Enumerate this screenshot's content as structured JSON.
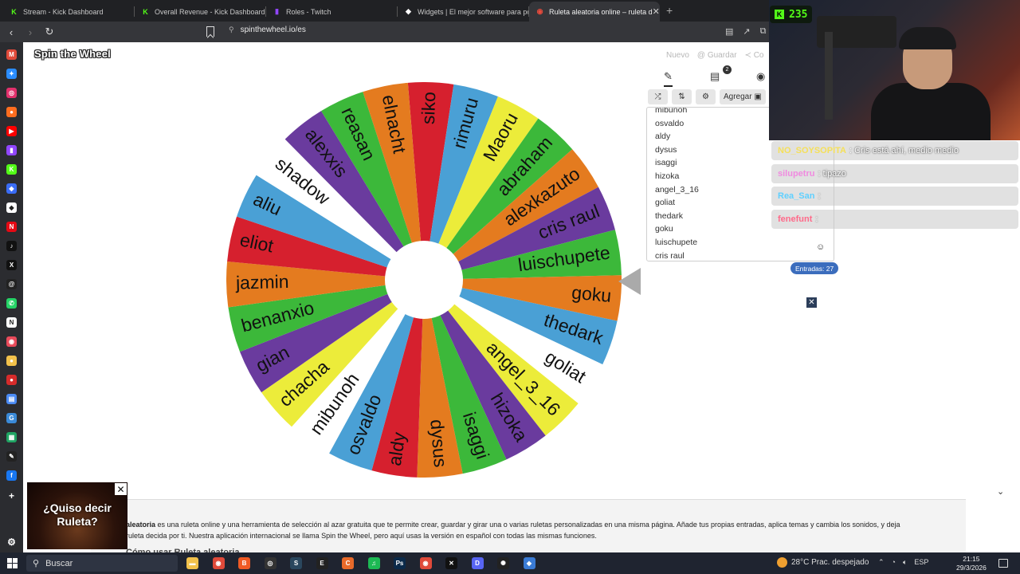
{
  "browser": {
    "tabs": [
      {
        "title": "Stream - Kick Dashboard",
        "favicon": "kick-icon",
        "color": "#53fc18",
        "glyph": "K",
        "active": false
      },
      {
        "title": "Overall Revenue - Kick Dashboard",
        "favicon": "kick-icon",
        "color": "#53fc18",
        "glyph": "K",
        "active": false
      },
      {
        "title": "Roles - Twitch",
        "favicon": "twitch-icon",
        "color": "#9146ff",
        "glyph": "▮",
        "active": false
      },
      {
        "title": "Widgets | El mejor software para pot",
        "favicon": "streamelements-icon",
        "color": "#ffffff",
        "glyph": "◆",
        "active": false
      },
      {
        "title": "Ruleta aleatoria online – ruleta d",
        "favicon": "spinthewheel-icon",
        "color": "#e94b3c",
        "glyph": "◉",
        "active": true
      }
    ],
    "url": "spinthewheel.io/es"
  },
  "page": {
    "logo": "Spin the Wheel",
    "top_links": [
      "Nuevo",
      "Guardar",
      "Co"
    ],
    "toolbar": {
      "add_label": "Agregar"
    },
    "entries_visible": [
      "mibunoh",
      "osvaldo",
      "aldy",
      "dysus",
      "isaggi",
      "hizoka",
      "angel_3_16",
      "goliat",
      "thedark",
      "goku",
      "luischupete",
      "cris raul"
    ],
    "entries_count_label": "Entradas: 27",
    "edit_badge": "2",
    "wheel": {
      "segments": [
        {
          "label": "siko",
          "color": "#d6202e"
        },
        {
          "label": "rimuru",
          "color": "#4aa0d5"
        },
        {
          "label": "Maoru",
          "color": "#ecec3a"
        },
        {
          "label": "abraham",
          "color": "#3cb83a"
        },
        {
          "label": "alexkazuto",
          "color": "#e47b1f"
        },
        {
          "label": "cris raul",
          "color": "#6a3b9e"
        },
        {
          "label": "luischupete",
          "color": "#3cb83a"
        },
        {
          "label": "goku",
          "color": "#e47b1f"
        },
        {
          "label": "thedark",
          "color": "#4aa0d5"
        },
        {
          "label": "goliat",
          "color": "#ffffff"
        },
        {
          "label": "angel_3_16",
          "color": "#ecec3a"
        },
        {
          "label": "hizoka",
          "color": "#6a3b9e"
        },
        {
          "label": "isaggi",
          "color": "#3cb83a"
        },
        {
          "label": "dysus",
          "color": "#e47b1f"
        },
        {
          "label": "aldy",
          "color": "#d6202e"
        },
        {
          "label": "osvaldo",
          "color": "#4aa0d5"
        },
        {
          "label": "mibunoh",
          "color": "#ffffff"
        },
        {
          "label": "chacha",
          "color": "#ecec3a"
        },
        {
          "label": "gian",
          "color": "#6a3b9e"
        },
        {
          "label": "benanxio",
          "color": "#3cb83a"
        },
        {
          "label": "jazmin",
          "color": "#e47b1f"
        },
        {
          "label": "eliot",
          "color": "#d6202e"
        },
        {
          "label": "aliu",
          "color": "#4aa0d5"
        },
        {
          "label": "shadow",
          "color": "#ffffff"
        },
        {
          "label": "alexxis",
          "color": "#6a3b9e"
        },
        {
          "label": "reasan",
          "color": "#3cb83a"
        },
        {
          "label": "elnacht",
          "color": "#e47b1f"
        }
      ]
    },
    "info": {
      "bold_word": "aleatoria",
      "text_line1": " es una ruleta online y una herramienta de selección al azar gratuita que te permite crear, guardar y girar una o varias ruletas personalizadas en una misma página. Añade tus propias entradas, aplica temas y cambia los sonidos, y deja",
      "text_line2": "ruleta decida por ti. Nuestra aplicación internacional se llama Spin the Wheel, pero aquí usas la versión en español con todas las mismas funciones.",
      "heading": "Cómo usar Ruleta aleatoria"
    },
    "ad": {
      "text": "¿Quiso decir Ruleta?"
    }
  },
  "overlay": {
    "viewer_count": "235",
    "chat": [
      {
        "user": "NO_SOYSOPITA",
        "user_color": "#f5e05a",
        "message": ": Cris está ahí, medio medio"
      },
      {
        "user": "silupetru",
        "user_color": "#f08ae0",
        "message": ": tipazo"
      },
      {
        "user": "Rea_San",
        "user_color": "#5fd0ff",
        "message": ":"
      },
      {
        "user": "fenefunt",
        "user_color": "#ff6a8a",
        "message": ":"
      }
    ]
  },
  "taskbar": {
    "search_label": "Buscar",
    "weather": "28°C  Prac. despejado",
    "lang": "ESP",
    "time": "21:15",
    "date": "29/3/2026",
    "apps": [
      {
        "name": "file-explorer-icon",
        "color": "#f2c14b",
        "glyph": "▬"
      },
      {
        "name": "chrome-icon",
        "color": "#e04a3a",
        "glyph": "◉"
      },
      {
        "name": "brave-icon",
        "color": "#f05a24",
        "glyph": "B"
      },
      {
        "name": "obs-icon",
        "color": "#333333",
        "glyph": "◎"
      },
      {
        "name": "steam-icon",
        "color": "#2a475e",
        "glyph": "S"
      },
      {
        "name": "epic-icon",
        "color": "#222222",
        "glyph": "E"
      },
      {
        "name": "app-orange-icon",
        "color": "#e86a2a",
        "glyph": "C"
      },
      {
        "name": "spotify-icon",
        "color": "#1db954",
        "glyph": "♫"
      },
      {
        "name": "photoshop-icon",
        "color": "#0b2a4a",
        "glyph": "Ps"
      },
      {
        "name": "chrome2-icon",
        "color": "#e04a3a",
        "glyph": "◉"
      },
      {
        "name": "capcut-icon",
        "color": "#111111",
        "glyph": "✕"
      },
      {
        "name": "discord-icon",
        "color": "#5865f2",
        "glyph": "D"
      },
      {
        "name": "openai-icon",
        "color": "#222222",
        "glyph": "✺"
      },
      {
        "name": "app-blue-icon",
        "color": "#3a7bd5",
        "glyph": "◆"
      }
    ]
  },
  "sidebar": {
    "items": [
      {
        "name": "gmail-icon",
        "color": "#e04a3a",
        "glyph": "M"
      },
      {
        "name": "messenger-icon",
        "color": "#2a8cff",
        "glyph": "✦"
      },
      {
        "name": "instagram-icon",
        "color": "#e1306c",
        "glyph": "◎"
      },
      {
        "name": "app-orange-icon",
        "color": "#ff6d1f",
        "glyph": "●"
      },
      {
        "name": "youtube-icon",
        "color": "#ff0000",
        "glyph": "▶"
      },
      {
        "name": "twitch-icon",
        "color": "#9146ff",
        "glyph": "▮"
      },
      {
        "name": "kick-icon",
        "color": "#53fc18",
        "glyph": "K"
      },
      {
        "name": "app-blue-icon",
        "color": "#3a6cf5",
        "glyph": "◆"
      },
      {
        "name": "streamlabs-icon",
        "color": "#ffffff",
        "glyph": "◆"
      },
      {
        "name": "netflix-icon",
        "color": "#e50914",
        "glyph": "N"
      },
      {
        "name": "tiktok-icon",
        "color": "#111111",
        "glyph": "♪"
      },
      {
        "name": "x-icon",
        "color": "#111111",
        "glyph": "X"
      },
      {
        "name": "threads-icon",
        "color": "#222222",
        "glyph": "@"
      },
      {
        "name": "whatsapp-icon",
        "color": "#25d366",
        "glyph": "✆"
      },
      {
        "name": "notion-icon",
        "color": "#ffffff",
        "glyph": "N"
      },
      {
        "name": "app-red-icon",
        "color": "#e84a5a",
        "glyph": "◉"
      },
      {
        "name": "app-yellow-icon",
        "color": "#f2c14b",
        "glyph": "●"
      },
      {
        "name": "app-red2-icon",
        "color": "#d62b2b",
        "glyph": "●"
      },
      {
        "name": "docs-icon",
        "color": "#4a8af4",
        "glyph": "▤"
      },
      {
        "name": "gif-icon",
        "color": "#3a8ad8",
        "glyph": "G"
      },
      {
        "name": "sheets-icon",
        "color": "#1fa463",
        "glyph": "▦"
      },
      {
        "name": "app-dark-icon",
        "color": "#222222",
        "glyph": "✎"
      },
      {
        "name": "facebook-icon",
        "color": "#1877f2",
        "glyph": "f"
      },
      {
        "name": "add-icon",
        "color": "#2b2c30",
        "glyph": "+"
      },
      {
        "name": "settings-icon",
        "color": "#2b2c30",
        "glyph": "⚙"
      }
    ]
  }
}
